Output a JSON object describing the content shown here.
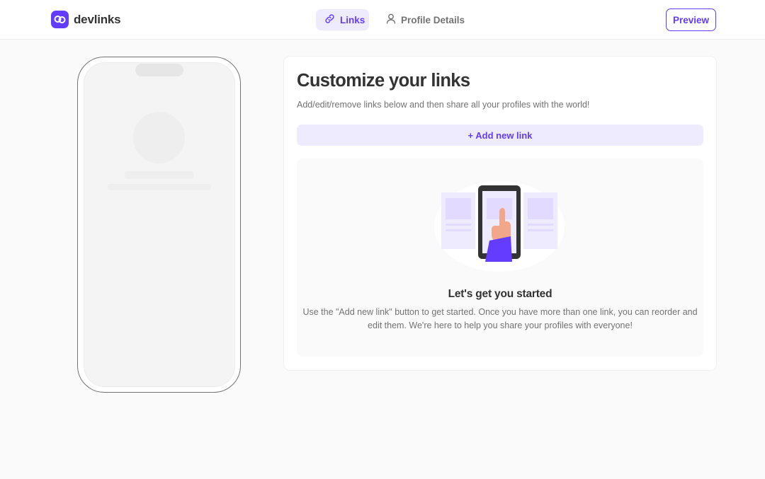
{
  "app": {
    "name": "devlinks"
  },
  "nav": {
    "tabs": [
      {
        "label": "Links",
        "icon": "link-icon",
        "active": true
      },
      {
        "label": "Profile Details",
        "icon": "user-icon",
        "active": false
      }
    ],
    "preview_label": "Preview"
  },
  "main": {
    "title": "Customize your links",
    "subtitle": "Add/edit/remove links below and then share all your profiles with the world!",
    "add_link_label": "+ Add new link",
    "empty_state": {
      "title": "Let's get you started",
      "text": "Use the \"Add new link\" button to get started. Once you have more than one link, you can reorder and edit them. We're here to help you share your profiles with everyone!"
    }
  },
  "colors": {
    "accent": "#633cff",
    "accent_light": "#efebff",
    "text_dark": "#333333",
    "text_gray": "#737373",
    "background": "#fafafa"
  }
}
